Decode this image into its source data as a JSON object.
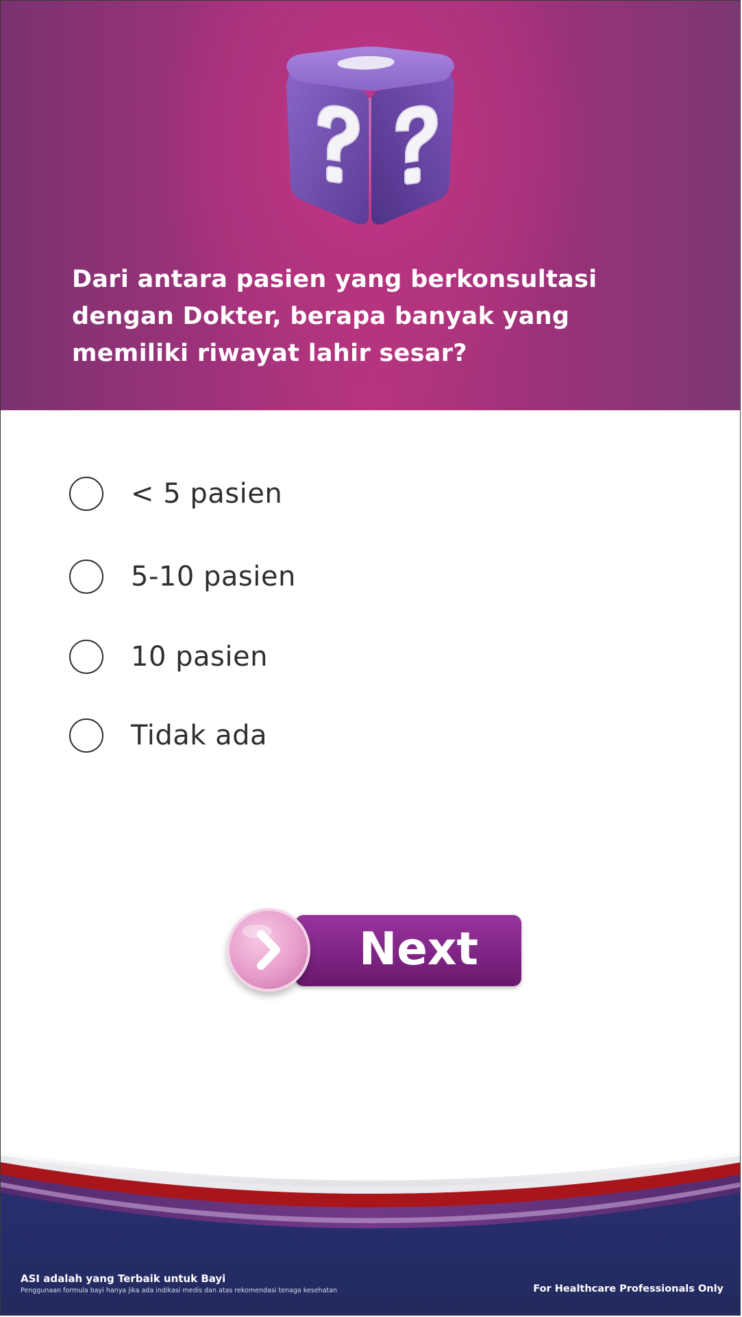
{
  "question": {
    "text": "Dari antara pasien yang berkonsultasi dengan Dokter, berapa banyak yang memiliki riwayat lahir sesar?"
  },
  "options": [
    {
      "label": "< 5 pasien",
      "selected": false
    },
    {
      "label": "5-10 pasien",
      "selected": false
    },
    {
      "label": "10 pasien",
      "selected": false
    },
    {
      "label": "Tidak ada",
      "selected": false
    }
  ],
  "next_button": {
    "label": "Next"
  },
  "footer": {
    "tagline": "ASI adalah yang Terbaik untuk Bayi",
    "disclaimer": "Penggunaan formula bayi hanya jika ada indikasi medis dan atas rekomendasi tenaga kesehatan",
    "audience": "For Healthcare Professionals Only"
  },
  "colors": {
    "header": "#b3337f",
    "button": "#7d2383",
    "footer_navy": "#27306e",
    "footer_red": "#a8161c"
  },
  "icons": {
    "hero": "question-mark-cube-icon",
    "next": "chevron-right-icon"
  }
}
